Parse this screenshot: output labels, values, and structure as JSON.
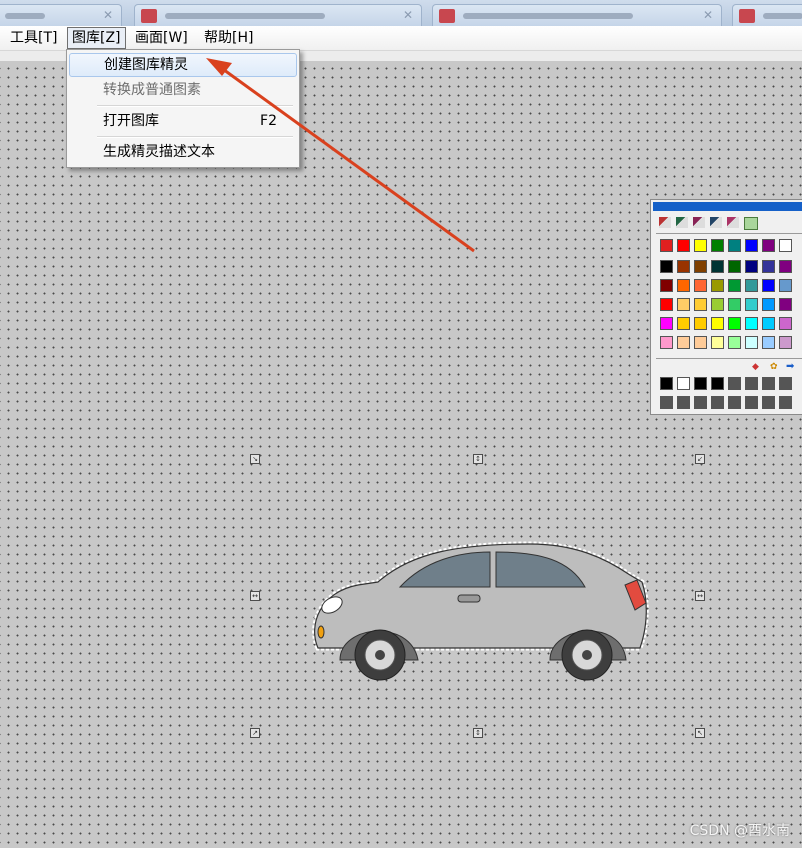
{
  "menubar": {
    "items": [
      {
        "label": "工具[T]"
      },
      {
        "label": "图库[Z]"
      },
      {
        "label": "画面[W]"
      },
      {
        "label": "帮助[H]"
      }
    ]
  },
  "dropdown": {
    "items": [
      {
        "label": "创建图库精灵",
        "shortcut": "",
        "state": "highlighted"
      },
      {
        "label": "转换成普通图素",
        "shortcut": "",
        "state": "disabled"
      },
      {
        "label": "打开图库",
        "shortcut": "F2",
        "state": "normal"
      },
      {
        "label": "生成精灵描述文本",
        "shortcut": "",
        "state": "normal"
      }
    ]
  },
  "palette": {
    "tools": [
      "pencil-icon",
      "line-icon",
      "fill-icon",
      "text-icon",
      "effect-icon",
      "pattern-icon"
    ],
    "top_row": [
      "#e02020",
      "#ff0000",
      "#ffff00",
      "#008000",
      "#008080",
      "#0000ff",
      "#800080",
      "#ffffff"
    ],
    "grid": [
      [
        "#000000",
        "#993300",
        "#804000",
        "#003333",
        "#006600",
        "#000080",
        "#333399",
        "#800080"
      ],
      [
        "#800000",
        "#ff6600",
        "#ff6633",
        "#999900",
        "#009933",
        "#339999",
        "#0000ff",
        "#6699cc"
      ],
      [
        "#ff0000",
        "#ffcc66",
        "#ffcc33",
        "#99cc33",
        "#33cc66",
        "#33cccc",
        "#0099ff",
        "#800080"
      ],
      [
        "#ff00ff",
        "#ffcc00",
        "#ffcc00",
        "#ffff00",
        "#00ff00",
        "#00ffff",
        "#00ccff",
        "#cc66cc"
      ],
      [
        "#ff99cc",
        "#ffcc99",
        "#ffcc99",
        "#ffff99",
        "#99ff99",
        "#ccffff",
        "#99ccff",
        "#cc99cc"
      ]
    ],
    "bottom_rows": [
      [
        "#000000",
        "#ffffff",
        "#000000",
        "#000000",
        "#555555",
        "#555555",
        "#555555",
        "#555555"
      ],
      [
        "#555555",
        "#555555",
        "#555555",
        "#555555",
        "#555555",
        "#555555",
        "#555555",
        "#555555"
      ]
    ]
  },
  "footer": {
    "watermark": "CSDN @酉水南"
  }
}
